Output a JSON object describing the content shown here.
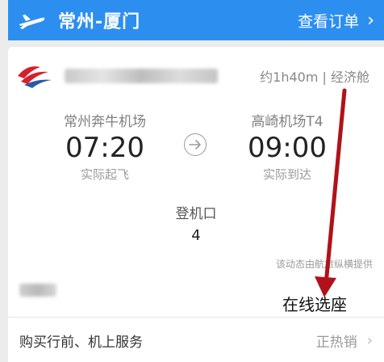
{
  "header": {
    "route": "常州-厦门",
    "orders_label": "查看订单",
    "chevron": "›",
    "plane_icon": "plane-icon",
    "bg_color": "#2c8ff0"
  },
  "flight": {
    "airline_logo": "china-eastern-logo",
    "duration_cabin": "约1h40m | 经济舱",
    "departure": {
      "airport": "常州奔牛机场",
      "time": "07:20",
      "status": "实际起飞"
    },
    "arrival": {
      "airport": "高崎机场T4",
      "time": "09:00",
      "status": "实际到达"
    },
    "arrow_icon": "arrow-right-circle-icon"
  },
  "gate": {
    "label": "登机口",
    "value": "4"
  },
  "source_text": "该动态由航旅纵横提供",
  "annotation": {
    "text": "在线选座",
    "color": "#b0121a"
  },
  "service": {
    "label": "购买行前、机上服务",
    "status": "正热销",
    "chevron": "›"
  }
}
